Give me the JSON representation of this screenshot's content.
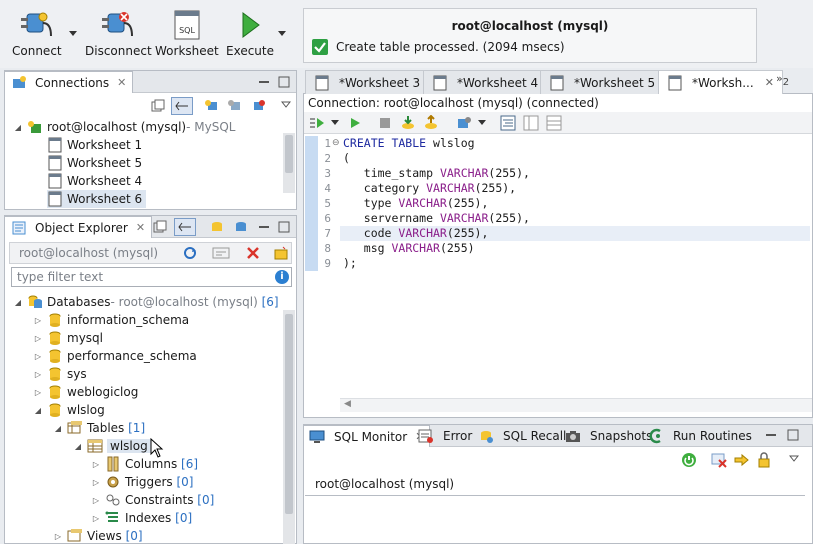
{
  "toolbar": {
    "connect": "Connect",
    "disconnect": "Disconnect",
    "worksheet": "Worksheet",
    "execute": "Execute"
  },
  "notification": {
    "title": "root@localhost (mysql)",
    "message": "Create table processed. (2094 msecs)"
  },
  "connections": {
    "tab_label": "Connections",
    "root_label": "root@localhost (mysql)",
    "root_suffix": " - MySQL",
    "items": [
      "Worksheet 1",
      "Worksheet 5",
      "Worksheet 4",
      "Worksheet 6"
    ]
  },
  "object_explorer": {
    "tab_label": "Object Explorer",
    "connection_label": "root@localhost (mysql)",
    "filter_placeholder": "type filter text",
    "databases_label": "Databases",
    "databases_suffix": " - root@localhost (mysql)",
    "databases_count": "[6]",
    "databases": [
      "information_schema",
      "mysql",
      "performance_schema",
      "sys",
      "weblogiclog",
      "wlslog"
    ],
    "tables_label": "Tables",
    "tables_count": "[1]",
    "table_name": "wlslog",
    "columns_label": "Columns",
    "columns_count": "[6]",
    "triggers_label": "Triggers",
    "triggers_count": "[0]",
    "constraints_label": "Constraints",
    "constraints_count": "[0]",
    "indexes_label": "Indexes",
    "indexes_count": "[0]",
    "views_label": "Views",
    "views_count": "[0]"
  },
  "editor": {
    "tabs": [
      "*Worksheet 3",
      "*Worksheet 4",
      "*Worksheet 5",
      "*Worksh..."
    ],
    "overflow": "2",
    "connection_status": "Connection: root@localhost (mysql) (connected)",
    "line_numbers": [
      "1",
      "2",
      "3",
      "4",
      "5",
      "6",
      "7",
      "8",
      "9"
    ],
    "code": {
      "l1_kw": "CREATE TABLE",
      "l1_rest": " wlslog",
      "l2": "(",
      "l3_col": "   time_stamp ",
      "l4_col": "   category ",
      "l5_col": "   type ",
      "l6_col": "   servername ",
      "l7_col": "   code ",
      "l8_col": "   msg ",
      "type_kw": "VARCHAR",
      "type_arg_comma": "(255),",
      "type_arg": "(255)",
      "l9": ");"
    }
  },
  "bottom": {
    "tabs": [
      "SQL Monitor",
      "Error",
      "SQL Recall",
      "Snapshots",
      "Run Routines"
    ],
    "monitor_connection": "root@localhost (mysql)"
  },
  "colors": {
    "accent": "#2b6fc1",
    "keyword": "#1e2aa0",
    "type": "#8a1e8a",
    "success": "#2ea043"
  }
}
